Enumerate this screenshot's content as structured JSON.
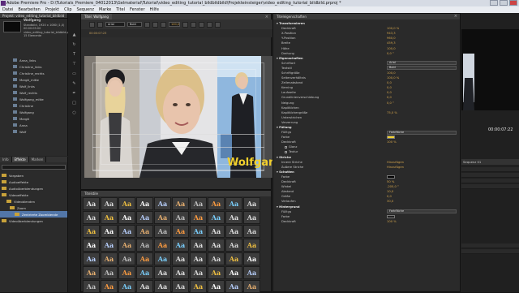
{
  "titlebar": {
    "title": "Adobe Premiere Pro - D:\\Tutorials_Premiere_04012013\\Gelmaterial\\Tutorial\\video_editing_tutorial_bildbildbild\\Projekteinsteiger\\video_editing_tutorial_bildbild.prproj *"
  },
  "menubar": {
    "items": [
      "Datei",
      "Bearbeiten",
      "Projekt",
      "Clip",
      "Sequenz",
      "Marke",
      "Titel",
      "Fenster",
      "Hilfe"
    ]
  },
  "project": {
    "tab_label": "Projekt: video_editing_tutorial_bildbild",
    "file_name": "Wolfgang",
    "meta_lines": [
      "Standbild, 1920 x 1080 (1,0)",
      "00:00:05:00",
      "video_editing_tutorial_bildbild.prproj",
      "15 Elemente"
    ],
    "items": [
      "Anna_links",
      "Christine_links",
      "Christine_rechts",
      "Margit_mitte",
      "Wolf_links",
      "Wolf_rechts",
      "Wolfgang_mitte",
      "Christine",
      "Wolfgang",
      "Margit",
      "Anna",
      "Wolf"
    ]
  },
  "effects": {
    "tabs": [
      "Info",
      "Effekte",
      "Marken"
    ],
    "search_placeholder": "",
    "items": [
      {
        "label": "Vorgaben",
        "highlight": false
      },
      {
        "label": "Audioeffekte",
        "highlight": false
      },
      {
        "label": "Audioüberblendungen",
        "highlight": false
      },
      {
        "label": "Videoeffekte",
        "highlight": false
      },
      {
        "label": "Videoblenden",
        "highlight": false
      },
      {
        "label": "Zoom",
        "highlight": false
      },
      {
        "label": "Zentrierte Zoomblende",
        "highlight": true
      },
      {
        "label": "Videoüberblendungen",
        "highlight": false
      }
    ]
  },
  "titler": {
    "tab_label": "Titel: Wolfgang",
    "font_family": "Arial",
    "font_style": "Bold",
    "font_size": "100,0",
    "toolbar2": [
      "00:00:07:23"
    ],
    "overlay_text": "Wolfgang"
  },
  "styles": {
    "tab_label": "Titelstile",
    "rows": 7,
    "cols": 10,
    "swatch_text": "Aa",
    "swatch_colors": [
      "#e0e0e0",
      "#d9d9d9",
      "#f0c040",
      "#ffffff",
      "#b8d0ff",
      "#e8b070",
      "#c0c0c0",
      "#ff9c40",
      "#7ad0ff",
      "#e0e0e0"
    ]
  },
  "properties": {
    "tab_label": "Titeleigenschaften",
    "rows": [
      {
        "type": "sec",
        "label": "Transformieren"
      },
      {
        "type": "val",
        "label": "Deckkraft",
        "value": "100,0 %"
      },
      {
        "type": "val",
        "label": "X-Position",
        "value": "943,3"
      },
      {
        "type": "val",
        "label": "Y-Position",
        "value": "960,0"
      },
      {
        "type": "val",
        "label": "Breite",
        "value": "459,3"
      },
      {
        "type": "val",
        "label": "Höhe",
        "value": "100,0"
      },
      {
        "type": "val",
        "label": "Drehung",
        "value": "0,0 °"
      },
      {
        "type": "sec",
        "label": "Eigenschaften"
      },
      {
        "type": "dd",
        "label": "Schriftart",
        "value": "Arial"
      },
      {
        "type": "dd",
        "label": "Textstil",
        "value": "Bold"
      },
      {
        "type": "val",
        "label": "Schriftgröße",
        "value": "100,0"
      },
      {
        "type": "val",
        "label": "Seitenverhältnis",
        "value": "100,0 %"
      },
      {
        "type": "val",
        "label": "Zeilenabstand",
        "value": "0,0"
      },
      {
        "type": "val",
        "label": "Kerning",
        "value": "0,0"
      },
      {
        "type": "val",
        "label": "Laufweite",
        "value": "0,0"
      },
      {
        "type": "val",
        "label": "Grundlinienverschiebung",
        "value": "0,0"
      },
      {
        "type": "val",
        "label": "Neigung",
        "value": "0,0 °"
      },
      {
        "type": "val",
        "label": "Kapitälchen",
        "value": ""
      },
      {
        "type": "val",
        "label": "Kapitälchengröße",
        "value": "75,0 %"
      },
      {
        "type": "val",
        "label": "Unterstrichen",
        "value": ""
      },
      {
        "type": "val",
        "label": "Verzerrung",
        "value": ""
      },
      {
        "type": "sec",
        "label": "Füllung"
      },
      {
        "type": "dd",
        "label": "Fülltyp",
        "value": "Farbfläche"
      },
      {
        "type": "swatch",
        "label": "Farbe",
        "color": "#f2d02c"
      },
      {
        "type": "val",
        "label": "Deckkraft",
        "value": "100 %"
      },
      {
        "type": "chk",
        "label": "Glanz",
        "value": ""
      },
      {
        "type": "chk",
        "label": "Textur",
        "value": ""
      },
      {
        "type": "sec",
        "label": "Striche"
      },
      {
        "type": "val",
        "label": "Innere Striche",
        "value": "Hinzufügen"
      },
      {
        "type": "val",
        "label": "Äußere Striche",
        "value": "Hinzufügen"
      },
      {
        "type": "sec",
        "label": "Schatten"
      },
      {
        "type": "swatch",
        "label": "Farbe",
        "color": "#000000"
      },
      {
        "type": "val",
        "label": "Deckkraft",
        "value": "50 %"
      },
      {
        "type": "val",
        "label": "Winkel",
        "value": "-205,0 °"
      },
      {
        "type": "val",
        "label": "Abstand",
        "value": "10,0"
      },
      {
        "type": "val",
        "label": "Größe",
        "value": "0,0"
      },
      {
        "type": "val",
        "label": "Verlaufen",
        "value": "30,0"
      },
      {
        "type": "sec",
        "label": "Hintergrund"
      },
      {
        "type": "dd",
        "label": "Fülltyp",
        "value": "Farbfläche"
      },
      {
        "type": "swatch",
        "label": "Farbe",
        "color": "#222222"
      },
      {
        "type": "val",
        "label": "Deckkraft",
        "value": "100 %"
      }
    ]
  },
  "program": {
    "timecode": "00:00:07:22",
    "timeline_tab": "Sequenz 01"
  },
  "colors": {
    "accent": "#5276a8",
    "value_orange": "#d4a54c",
    "title_yellow": "#f2d02c"
  }
}
